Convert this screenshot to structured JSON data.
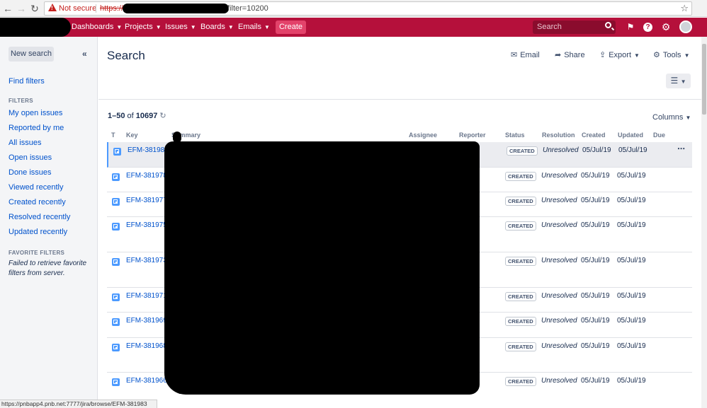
{
  "browser": {
    "security_label": "Not secure",
    "url_scheme": "https://",
    "url_tail": "filter=10200",
    "status_url": "https://pnbapp4.pnb.net:7777/jira/browse/EFM-381983"
  },
  "header": {
    "nav": [
      {
        "label": "Dashboards"
      },
      {
        "label": "Projects"
      },
      {
        "label": "Issues"
      },
      {
        "label": "Boards"
      },
      {
        "label": "Emails"
      }
    ],
    "create_label": "Create",
    "search_placeholder": "Search",
    "brand_color": "#b5103b"
  },
  "sidebar": {
    "new_search_label": "New search",
    "find_filters_label": "Find filters",
    "filters_heading": "FILTERS",
    "filters": [
      {
        "label": "My open issues"
      },
      {
        "label": "Reported by me"
      },
      {
        "label": "All issues"
      },
      {
        "label": "Open issues"
      },
      {
        "label": "Done issues"
      },
      {
        "label": "Viewed recently"
      },
      {
        "label": "Created recently"
      },
      {
        "label": "Resolved recently"
      },
      {
        "label": "Updated recently"
      }
    ],
    "favorite_heading": "FAVORITE FILTERS",
    "favorite_error": "Failed to retrieve favorite filters from server."
  },
  "main": {
    "title": "Search",
    "tools": {
      "email": "Email",
      "share": "Share",
      "export": "Export",
      "tools": "Tools"
    },
    "count_range": "1–50",
    "count_of": "of",
    "count_total": "10697",
    "columns_label": "Columns",
    "headers": {
      "t": "T",
      "key": "Key",
      "summary": "Summary",
      "assignee": "Assignee",
      "reporter": "Reporter",
      "status": "Status",
      "resolution": "Resolution",
      "created": "Created",
      "updated": "Updated",
      "due": "Due"
    },
    "rows": [
      {
        "key": "EFM-381983",
        "status": "CREATED",
        "resolution": "Unresolved",
        "created": "05/Jul/19",
        "updated": "05/Jul/19"
      },
      {
        "key": "EFM-381978",
        "status": "CREATED",
        "resolution": "Unresolved",
        "created": "05/Jul/19",
        "updated": "05/Jul/19"
      },
      {
        "key": "EFM-381977",
        "status": "CREATED",
        "resolution": "Unresolved",
        "created": "05/Jul/19",
        "updated": "05/Jul/19"
      },
      {
        "key": "EFM-381975",
        "status": "CREATED",
        "resolution": "Unresolved",
        "created": "05/Jul/19",
        "updated": "05/Jul/19"
      },
      {
        "key": "EFM-381973",
        "status": "CREATED",
        "resolution": "Unresolved",
        "created": "05/Jul/19",
        "updated": "05/Jul/19"
      },
      {
        "key": "EFM-381971",
        "status": "CREATED",
        "resolution": "Unresolved",
        "created": "05/Jul/19",
        "updated": "05/Jul/19"
      },
      {
        "key": "EFM-381969",
        "status": "CREATED",
        "resolution": "Unresolved",
        "created": "05/Jul/19",
        "updated": "05/Jul/19"
      },
      {
        "key": "EFM-381968",
        "status": "CREATED",
        "resolution": "Unresolved",
        "created": "05/Jul/19",
        "updated": "05/Jul/19"
      },
      {
        "key": "EFM-381966",
        "status": "CREATED",
        "resolution": "Unresolved",
        "created": "05/Jul/19",
        "updated": "05/Jul/19"
      }
    ]
  }
}
